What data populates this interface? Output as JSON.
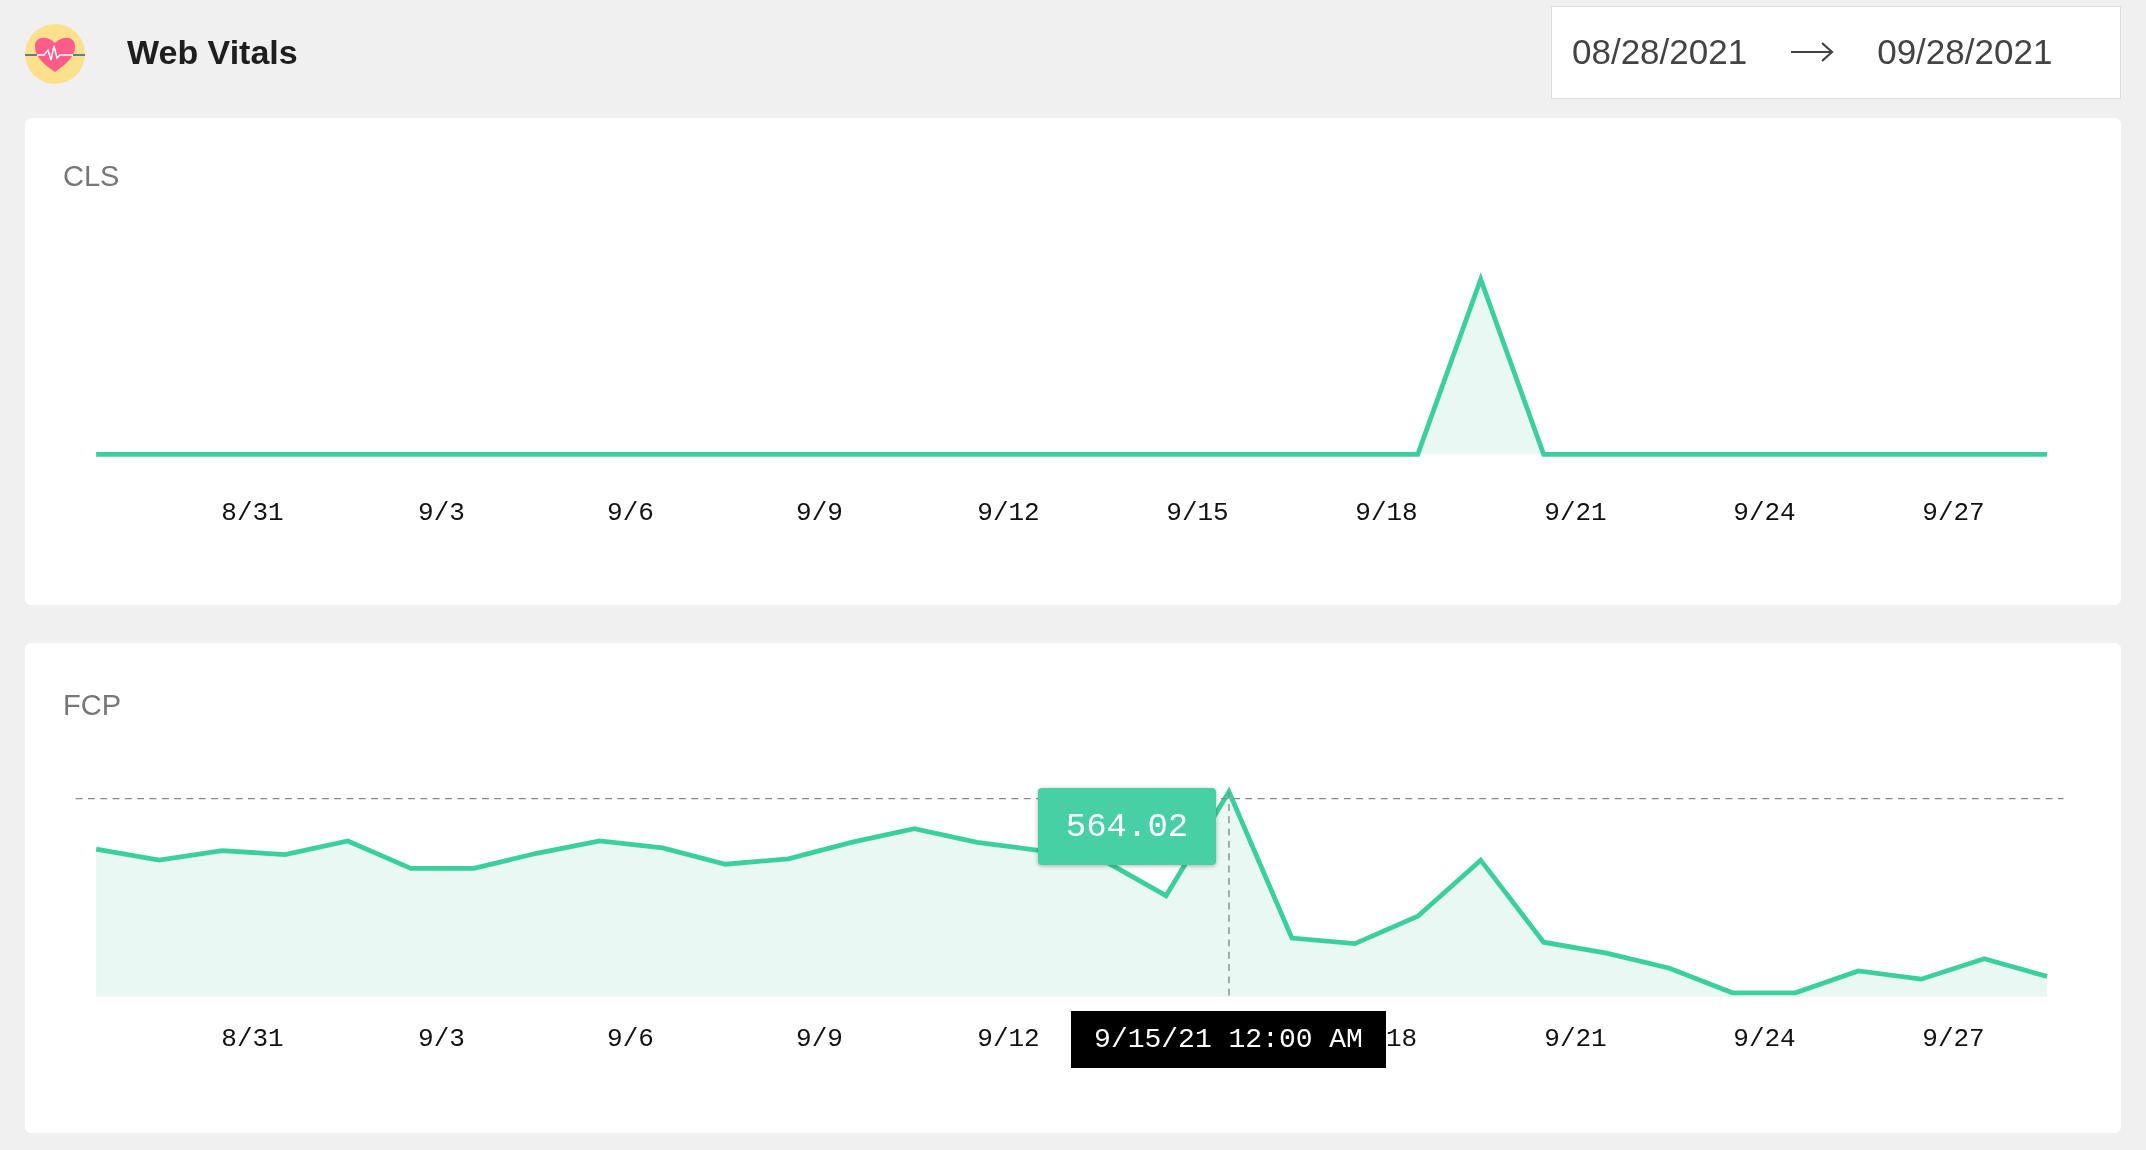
{
  "header": {
    "title": "Web Vitals",
    "date_range": {
      "start": "08/28/2021",
      "end": "09/28/2021"
    }
  },
  "charts": [
    {
      "title": "CLS",
      "x_axis": [
        {
          "kind": "label",
          "text": "8/31"
        },
        {
          "kind": "label",
          "text": "9/3"
        },
        {
          "kind": "label",
          "text": "9/6"
        },
        {
          "kind": "label",
          "text": "9/9"
        },
        {
          "kind": "label",
          "text": "9/12"
        },
        {
          "kind": "label",
          "text": "9/15"
        },
        {
          "kind": "label",
          "text": "9/18"
        },
        {
          "kind": "label",
          "text": "9/21"
        },
        {
          "kind": "label",
          "text": "9/24"
        },
        {
          "kind": "label",
          "text": "9/27"
        }
      ]
    },
    {
      "title": "FCP",
      "hover_value": "564.02",
      "x_axis": [
        {
          "kind": "label",
          "text": "8/31"
        },
        {
          "kind": "label",
          "text": "9/3"
        },
        {
          "kind": "label",
          "text": "9/6"
        },
        {
          "kind": "label",
          "text": "9/9"
        },
        {
          "kind": "label",
          "text": "9/12"
        },
        {
          "kind": "tooltip",
          "text": "9/15/21 12:00 AM"
        },
        {
          "kind": "partial",
          "text": "18"
        },
        {
          "kind": "label",
          "text": "9/21"
        },
        {
          "kind": "label",
          "text": "9/24"
        },
        {
          "kind": "label",
          "text": "9/27"
        }
      ]
    }
  ]
}
